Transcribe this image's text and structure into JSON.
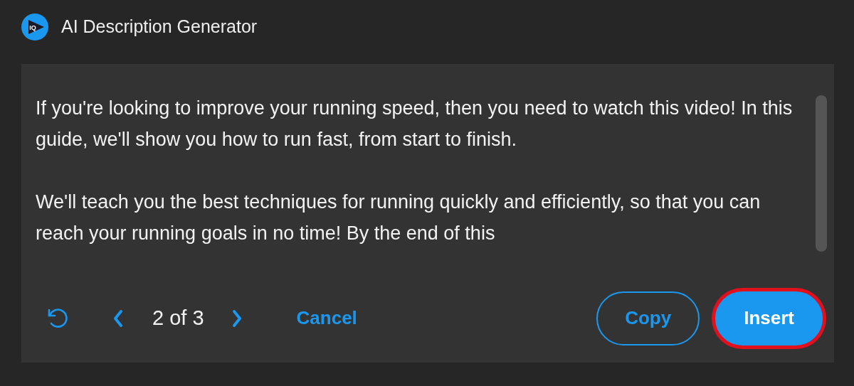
{
  "header": {
    "logo_text": "IQ",
    "title": "AI Description Generator"
  },
  "description": {
    "paragraphs": [
      "If you're looking to improve your running speed, then you need to watch this video! In this guide, we'll show you how to run fast, from start to finish.",
      "We'll teach you the best techniques for running quickly and efficiently, so that you can reach your running goals in no time! By the end of this"
    ]
  },
  "footer": {
    "pager": "2 of 3",
    "cancel": "Cancel",
    "buttons": [
      {
        "label": "Copy",
        "kind": "outline",
        "highlighted": false
      },
      {
        "label": "Insert",
        "kind": "filled",
        "highlighted": true
      }
    ]
  }
}
